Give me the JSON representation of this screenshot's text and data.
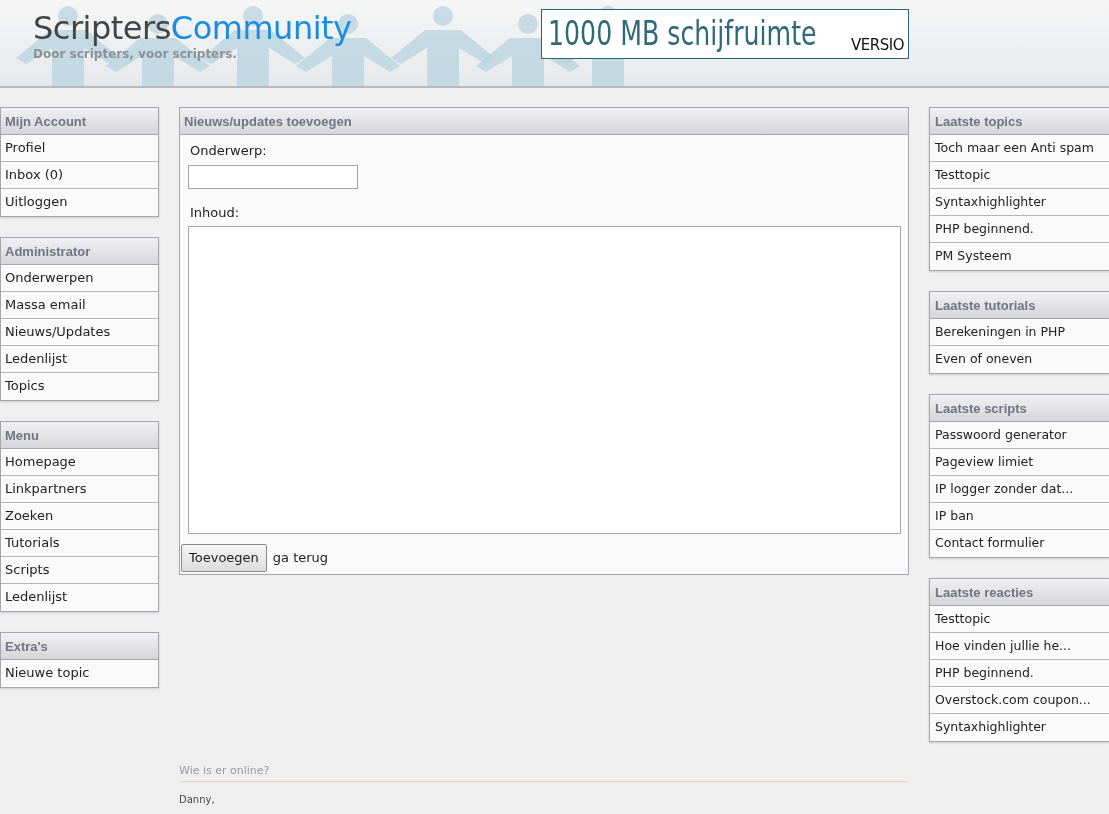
{
  "header": {
    "logo": {
      "word_1": "Scripters",
      "word_2": "Community"
    },
    "tagline": "Door scripters, voor scripters.",
    "banner": {
      "text": "1000 MB schijfruimte",
      "brand": "VERSIO"
    }
  },
  "left_sidebar": [
    {
      "title": "Mijn Account",
      "items": [
        "Profiel",
        "Inbox (0)",
        "Uitloggen"
      ]
    },
    {
      "title": "Administrator",
      "items": [
        "Onderwerpen",
        "Massa email",
        "Nieuws/Updates",
        "Ledenlijst",
        "Topics"
      ]
    },
    {
      "title": "Menu",
      "items": [
        "Homepage",
        "Linkpartners",
        "Zoeken",
        "Tutorials",
        "Scripts",
        "Ledenlijst"
      ]
    },
    {
      "title": "Extra's",
      "items": [
        "Nieuwe topic"
      ]
    }
  ],
  "form": {
    "title": "Nieuws/updates toevoegen",
    "subject_label": "Onderwerp:",
    "content_label": "Inhoud:",
    "submit": "Toevoegen",
    "back_link": "ga terug"
  },
  "online": {
    "title": "Wie is er online?",
    "users": "Danny,"
  },
  "right_sidebar": [
    {
      "title": "Laatste topics",
      "items": [
        "Toch maar een Anti spam",
        "Testtopic",
        "Syntaxhighlighter",
        "PHP beginnend.",
        "PM Systeem"
      ]
    },
    {
      "title": "Laatste tutorials",
      "items": [
        "Berekeningen in PHP",
        "Even of oneven"
      ]
    },
    {
      "title": "Laatste scripts",
      "items": [
        "Passwoord generator",
        "Pageview limiet",
        "IP logger zonder dat...",
        "IP ban",
        "Contact formulier"
      ]
    },
    {
      "title": "Laatste reacties",
      "items": [
        "Testtopic",
        "Hoe vinden jullie he...",
        "PHP beginnend.",
        "Overstock.com coupon...",
        "Syntaxhighlighter"
      ]
    }
  ]
}
